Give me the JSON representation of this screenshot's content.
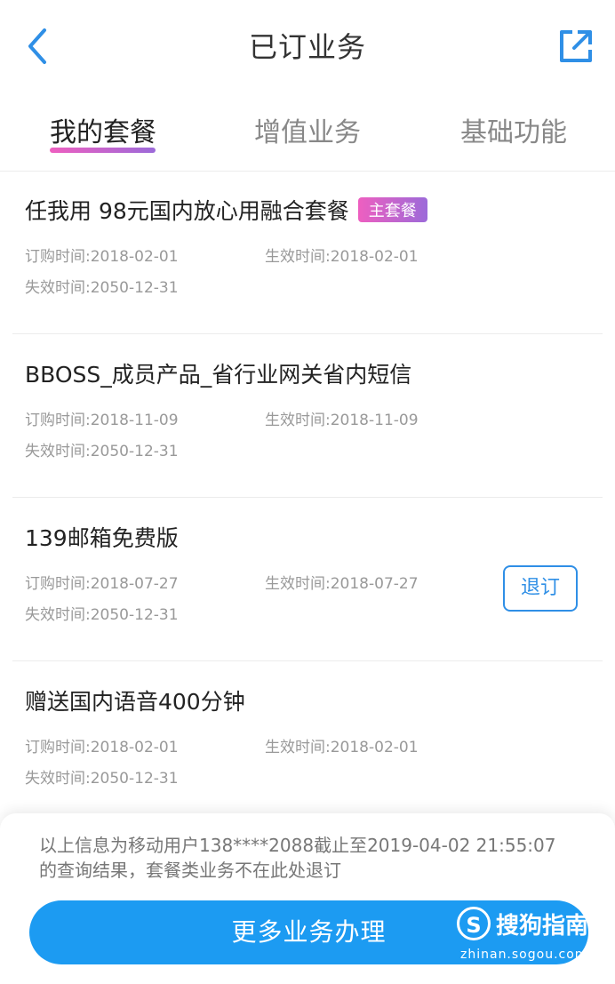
{
  "header": {
    "title": "已订业务",
    "back_icon": "chevron-left-icon",
    "share_icon": "share-icon"
  },
  "tabs": [
    {
      "label": "我的套餐",
      "active": true
    },
    {
      "label": "增值业务",
      "active": false
    },
    {
      "label": "基础功能",
      "active": false
    }
  ],
  "colors": {
    "accent": "#1c9bf2",
    "tab_gradient_start": "#ee5fc0",
    "tab_gradient_end": "#9c6ad9",
    "outline": "#2f8fe6"
  },
  "items": [
    {
      "name": "任我用 98元国内放心用融合套餐",
      "badge": "主套餐",
      "order_time": "订购时间:2018-02-01",
      "effective_time": "生效时间:2018-02-01",
      "expire_time": "失效时间:2050-12-31"
    },
    {
      "name": "BBOSS_成员产品_省行业网关省内短信",
      "order_time": "订购时间:2018-11-09",
      "effective_time": "生效时间:2018-11-09",
      "expire_time": "失效时间:2050-12-31"
    },
    {
      "name": "139邮箱免费版",
      "action": "退订",
      "order_time": "订购时间:2018-07-27",
      "effective_time": "生效时间:2018-07-27",
      "expire_time": "失效时间:2050-12-31"
    },
    {
      "name": "赠送国内语音400分钟",
      "order_time": "订购时间:2018-02-01",
      "effective_time": "生效时间:2018-02-01",
      "expire_time": "失效时间:2050-12-31"
    }
  ],
  "footer": {
    "notice_line1": "以上信息为移动用户138****2088截止至2019-04-02 21:55:07",
    "notice_line2": "的查询结果，套餐类业务不在此处退订",
    "more_button": "更多业务办理"
  },
  "watermark": {
    "logo": "S",
    "text": "搜狗指南",
    "url": "zhinan.sogou.com"
  }
}
